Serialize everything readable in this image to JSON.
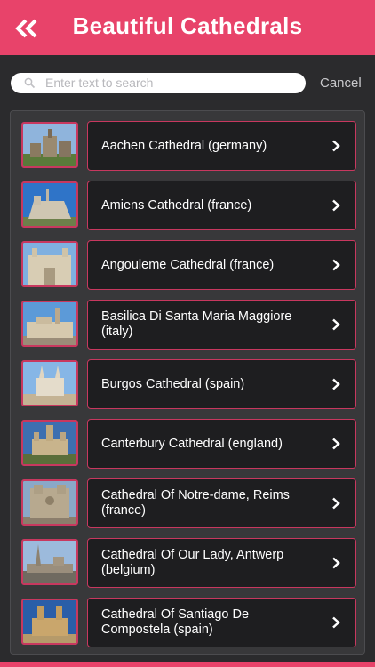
{
  "header": {
    "title": "Beautiful Cathedrals",
    "back_icon": "double-chevron-left-icon"
  },
  "search": {
    "placeholder": "Enter text to search",
    "cancel_label": "Cancel"
  },
  "colors": {
    "accent": "#e8436a",
    "card_bg": "#1e1e20",
    "panel_bg": "#38383a",
    "border": "#c8385f"
  },
  "items": [
    {
      "label": "Aachen Cathedral (germany)"
    },
    {
      "label": "Amiens Cathedral (france)"
    },
    {
      "label": "Angouleme Cathedral (france)"
    },
    {
      "label": "Basilica Di Santa Maria Maggiore (italy)"
    },
    {
      "label": "Burgos Cathedral (spain)"
    },
    {
      "label": "Canterbury Cathedral (england)"
    },
    {
      "label": "Cathedral Of Notre-dame, Reims (france)"
    },
    {
      "label": "Cathedral Of Our Lady, Antwerp (belgium)"
    },
    {
      "label": "Cathedral Of Santiago De Compostela (spain)"
    }
  ]
}
